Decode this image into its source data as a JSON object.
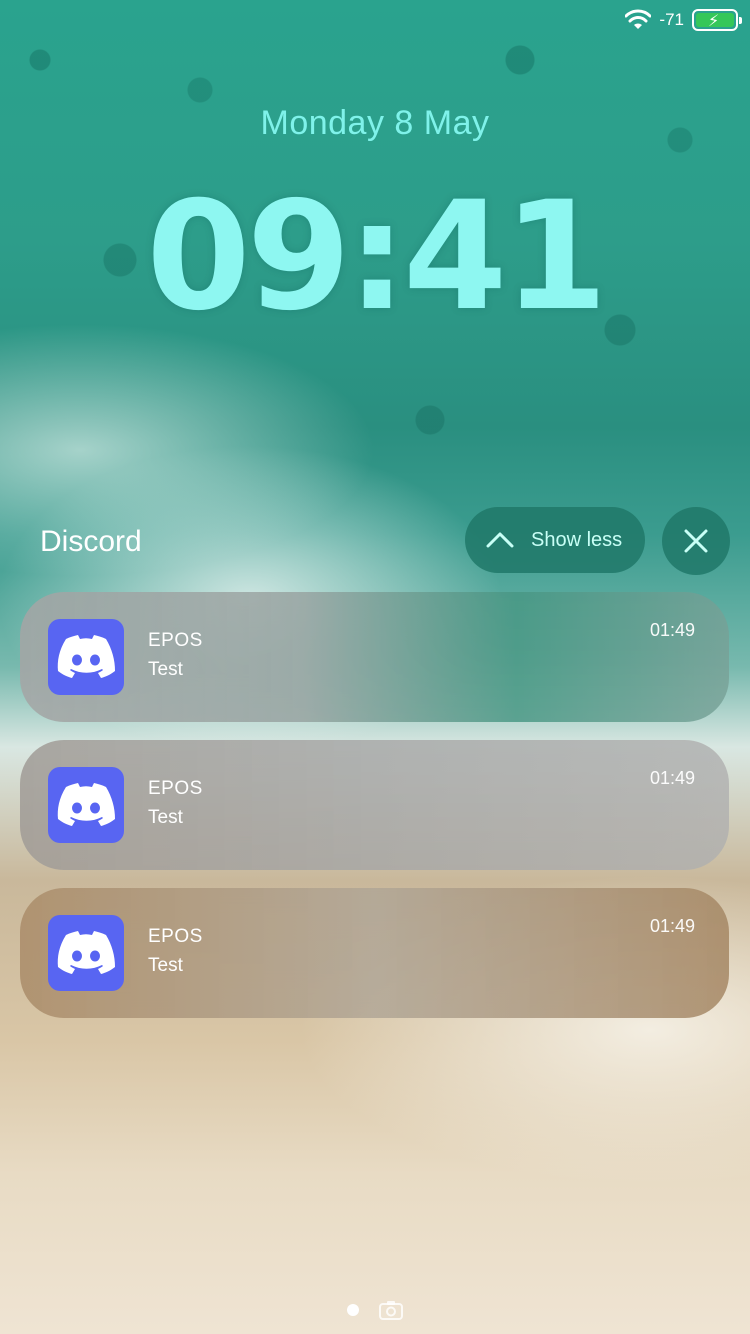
{
  "status": {
    "signal_value": "-71",
    "battery_color": "#35c759"
  },
  "lockscreen": {
    "date": "Monday 8 May",
    "time": "09:41"
  },
  "group": {
    "app_name": "Discord",
    "show_less_label": "Show less"
  },
  "notifications": [
    {
      "title": "EPOS",
      "body": "Test",
      "time": "01:49"
    },
    {
      "title": "EPOS",
      "body": "Test",
      "time": "01:49"
    },
    {
      "title": "EPOS",
      "body": "Test",
      "time": "01:49"
    }
  ],
  "colors": {
    "accent": "#8ef7f1",
    "discord": "#5865f2"
  }
}
